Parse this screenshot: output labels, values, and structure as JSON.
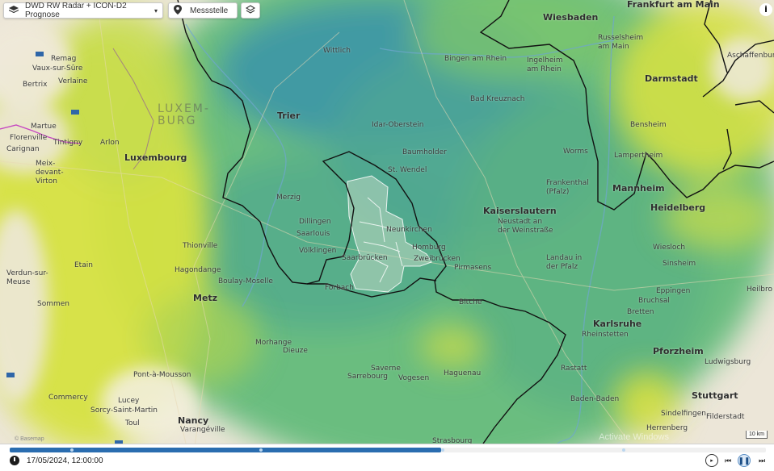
{
  "toolbar": {
    "layer_select_label": "DWD RW Radar + ICON-D2 Prognose",
    "station_label": "Messstelle"
  },
  "info_label": "i",
  "scale_label": "10 km",
  "attribution": "© Basemap",
  "watermark": "Activate Windows",
  "timeline": {
    "datetime": "17/05/2024, 12:00:00",
    "progress": 0.57
  },
  "map": {
    "countries": [
      {
        "id": "lux",
        "text": "LUXEM-\nBURG"
      }
    ],
    "towns": [
      {
        "id": "remag",
        "text": "Remag"
      },
      {
        "id": "vaux",
        "text": "Vaux-sur-Sûre"
      },
      {
        "id": "bertrix",
        "text": "Bertrix"
      },
      {
        "id": "verlaine",
        "text": "Verlaine"
      },
      {
        "id": "martue",
        "text": "Martue"
      },
      {
        "id": "florenville",
        "text": "Florenville"
      },
      {
        "id": "tintigny",
        "text": "Tintigny"
      },
      {
        "id": "carignan",
        "text": "Carignan"
      },
      {
        "id": "arlon",
        "text": "Arlon"
      },
      {
        "id": "meix",
        "text": "Meix-\ndevant-\nVirton"
      },
      {
        "id": "luxembourg",
        "text": "Luxembourg",
        "big": true
      },
      {
        "id": "trier",
        "text": "Trier",
        "big": true
      },
      {
        "id": "merzig",
        "text": "Merzig"
      },
      {
        "id": "saarlouis",
        "text": "Saarlouis"
      },
      {
        "id": "volklingen",
        "text": "Völklingen"
      },
      {
        "id": "saarbrucken",
        "text": "Saarbrücken"
      },
      {
        "id": "kaiserslautern",
        "text": "Kaiserslautern",
        "big": true
      },
      {
        "id": "neustadt",
        "text": "Neustadt an\nder Weinstraße"
      },
      {
        "id": "landau",
        "text": "Landau in\nder Pfalz"
      },
      {
        "id": "pirmasens",
        "text": "Pirmasens"
      },
      {
        "id": "idar",
        "text": "Idar-Oberstein"
      },
      {
        "id": "badkreuznach",
        "text": "Bad Kreuznach"
      },
      {
        "id": "bingen",
        "text": "Bingen am Rhein"
      },
      {
        "id": "ingelheim",
        "text": "Ingelheim\nam Rhein"
      },
      {
        "id": "wiesbaden",
        "text": "Wiesbaden",
        "big": true
      },
      {
        "id": "frankfurt",
        "text": "Frankfurt am Main",
        "big": true
      },
      {
        "id": "russelsheim",
        "text": "Russelsheim\nam Main"
      },
      {
        "id": "darmstadt",
        "text": "Darmstadt",
        "big": true
      },
      {
        "id": "aschaffenburg",
        "text": "Aschaffenburg"
      },
      {
        "id": "worms",
        "text": "Worms"
      },
      {
        "id": "frankenthal",
        "text": "Frankenthal\n(Pfalz)"
      },
      {
        "id": "mannheim",
        "text": "Mannheim",
        "big": true
      },
      {
        "id": "heidelberg",
        "text": "Heidelberg",
        "big": true
      },
      {
        "id": "wiesloch",
        "text": "Wiesloch"
      },
      {
        "id": "sinsheim",
        "text": "Sinsheim"
      },
      {
        "id": "eppingen",
        "text": "Eppingen"
      },
      {
        "id": "bruchsal",
        "text": "Bruchsal"
      },
      {
        "id": "karlsruhe",
        "text": "Karlsruhe",
        "big": true
      },
      {
        "id": "pforzheim",
        "text": "Pforzheim",
        "big": true
      },
      {
        "id": "heilbronn",
        "text": "Heilbro"
      },
      {
        "id": "ludwigsburg",
        "text": "Ludwigsburg"
      },
      {
        "id": "stuttgart",
        "text": "Stuttgart",
        "big": true
      },
      {
        "id": "sindelfingen",
        "text": "Sindelfingen"
      },
      {
        "id": "rastatt",
        "text": "Rastatt"
      },
      {
        "id": "badenbaden",
        "text": "Baden-Baden"
      },
      {
        "id": "haguenau",
        "text": "Haguenau"
      },
      {
        "id": "strasbourg",
        "text": "Strasbourg"
      },
      {
        "id": "metz",
        "text": "Metz",
        "big": true
      },
      {
        "id": "nancy",
        "text": "Nancy",
        "big": true
      },
      {
        "id": "verdun",
        "text": "Verdun-sur-\nMeuse"
      },
      {
        "id": "etain",
        "text": "Etain"
      },
      {
        "id": "pontamousson",
        "text": "Pont-à-Mousson"
      },
      {
        "id": "sarrebourg",
        "text": "Sarrebourg"
      },
      {
        "id": "saverne",
        "text": "Saverne"
      },
      {
        "id": "vogesen",
        "text": "Vogesen"
      },
      {
        "id": "sommen",
        "text": "Sommen"
      },
      {
        "id": "commercy",
        "text": "Commercy"
      },
      {
        "id": "lucey",
        "text": "Lucey"
      },
      {
        "id": "sorcy",
        "text": "Sorcy-Saint-Martin"
      },
      {
        "id": "toul",
        "text": "Toul"
      },
      {
        "id": "varangeville",
        "text": "Varangéville"
      },
      {
        "id": "wittlich",
        "text": "Wittlich"
      },
      {
        "id": "baumholder",
        "text": "Baumholder"
      },
      {
        "id": "homburg",
        "text": "Homburg"
      },
      {
        "id": "zweibrucken",
        "text": "Zweibrücken"
      },
      {
        "id": "rheinstetten",
        "text": "Rheinstetten"
      },
      {
        "id": "bretten",
        "text": "Bretten"
      },
      {
        "id": "bitche",
        "text": "Bitche"
      },
      {
        "id": "forbach",
        "text": "Forbach"
      },
      {
        "id": "thionville",
        "text": "Thionville"
      },
      {
        "id": "dillingen",
        "text": "Dillingen"
      },
      {
        "id": "stwendel",
        "text": "St. Wendel"
      },
      {
        "id": "neunkirchen",
        "text": "Neunkirchen"
      },
      {
        "id": "hagondange",
        "text": "Hagondange"
      },
      {
        "id": "boulay",
        "text": "Boulay-Moselle"
      },
      {
        "id": "morhange",
        "text": "Morhange"
      },
      {
        "id": "dieuze",
        "text": "Dieuze"
      },
      {
        "id": "herrenberg",
        "text": "Herrenberg"
      },
      {
        "id": "filderstadt",
        "text": "Filderstadt"
      },
      {
        "id": "bensheim",
        "text": "Bensheim"
      },
      {
        "id": "lampertheim",
        "text": "Lampertheim"
      }
    ]
  }
}
